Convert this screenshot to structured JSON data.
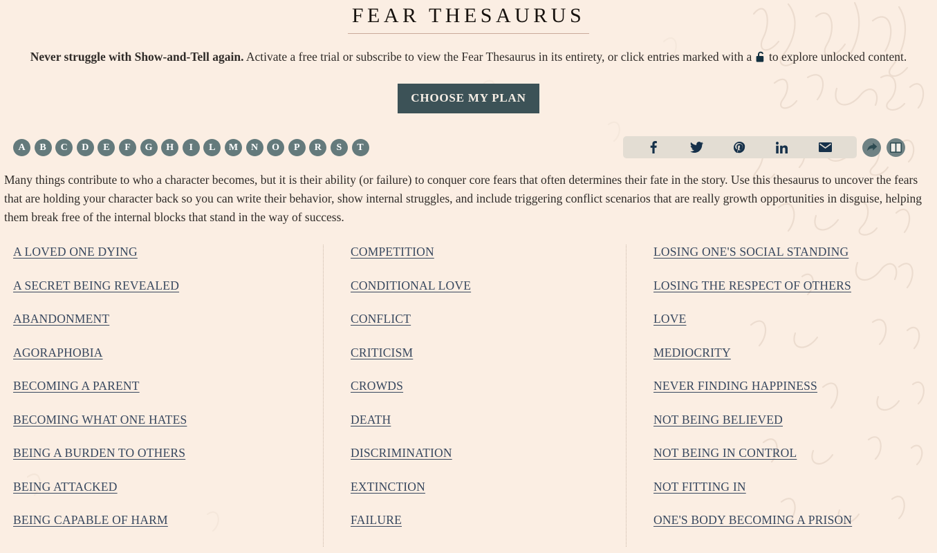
{
  "header": {
    "title": "FEAR THESAURUS"
  },
  "promo": {
    "bold_lead": "Never struggle with Show-and-Tell again.",
    "text_part1": " Activate a free trial or subscribe to view the Fear Thesaurus in its entirety, or click entries marked with a ",
    "lock_icon": "unlock-icon",
    "text_part2": " to explore unlocked content.",
    "cta_label": "CHOOSE MY PLAN",
    "cta_bg": "#3c5257",
    "cta_text_color": "#f7efe6"
  },
  "alphabet": {
    "letters": [
      "A",
      "B",
      "C",
      "D",
      "E",
      "F",
      "G",
      "H",
      "I",
      "L",
      "M",
      "N",
      "O",
      "P",
      "R",
      "S",
      "T"
    ],
    "badge_bg": "#647a7c",
    "badge_text_color": "#ffffff"
  },
  "share": {
    "items": [
      {
        "name": "facebook-icon",
        "label": "f"
      },
      {
        "name": "twitter-icon",
        "label": "Twitter"
      },
      {
        "name": "pinterest-icon",
        "label": "Pinterest"
      },
      {
        "name": "linkedin-icon",
        "label": "in"
      },
      {
        "name": "email-icon",
        "label": "Email"
      }
    ],
    "bar_bg": "#e3ddd3",
    "icon_color": "#16314a",
    "round_buttons": [
      {
        "name": "share-icon",
        "label": "Share"
      },
      {
        "name": "book-icon",
        "label": "Read"
      }
    ],
    "round_bg": "#6f8284"
  },
  "intro": {
    "paragraph": "Many things contribute to who a character becomes, but it is their ability (or failure) to conquer core fears that often determines their fate in the story. Use this thesaurus to uncover the fears that are holding your character back so you can write their behavior, show internal struggles, and include triggering conflict scenarios that are really growth opportunities in disguise, helping them break free of the internal blocks that stand in the way of success."
  },
  "entries": {
    "link_color": "#37475e",
    "columns": [
      [
        "A LOVED ONE DYING",
        "A SECRET BEING REVEALED",
        "ABANDONMENT",
        "AGORAPHOBIA",
        "BECOMING A PARENT",
        "BECOMING WHAT ONE HATES",
        "BEING A BURDEN TO OTHERS",
        "BEING ATTACKED",
        "BEING CAPABLE OF HARM"
      ],
      [
        "COMPETITION",
        "CONDITIONAL LOVE",
        "CONFLICT",
        "CRITICISM",
        "CROWDS",
        "DEATH",
        "DISCRIMINATION",
        "EXTINCTION",
        "FAILURE"
      ],
      [
        "LOSING ONE'S SOCIAL STANDING",
        "LOSING THE RESPECT OF OTHERS",
        "LOVE",
        "MEDIOCRITY",
        "NEVER FINDING HAPPINESS",
        "NOT BEING BELIEVED",
        "NOT BEING IN CONTROL",
        "NOT FITTING IN",
        "ONE'S BODY BECOMING A PRISON"
      ]
    ]
  },
  "theme": {
    "background": "#fbeee3",
    "divider": "#cbb8a9",
    "title_underline": "#c9a99a"
  }
}
